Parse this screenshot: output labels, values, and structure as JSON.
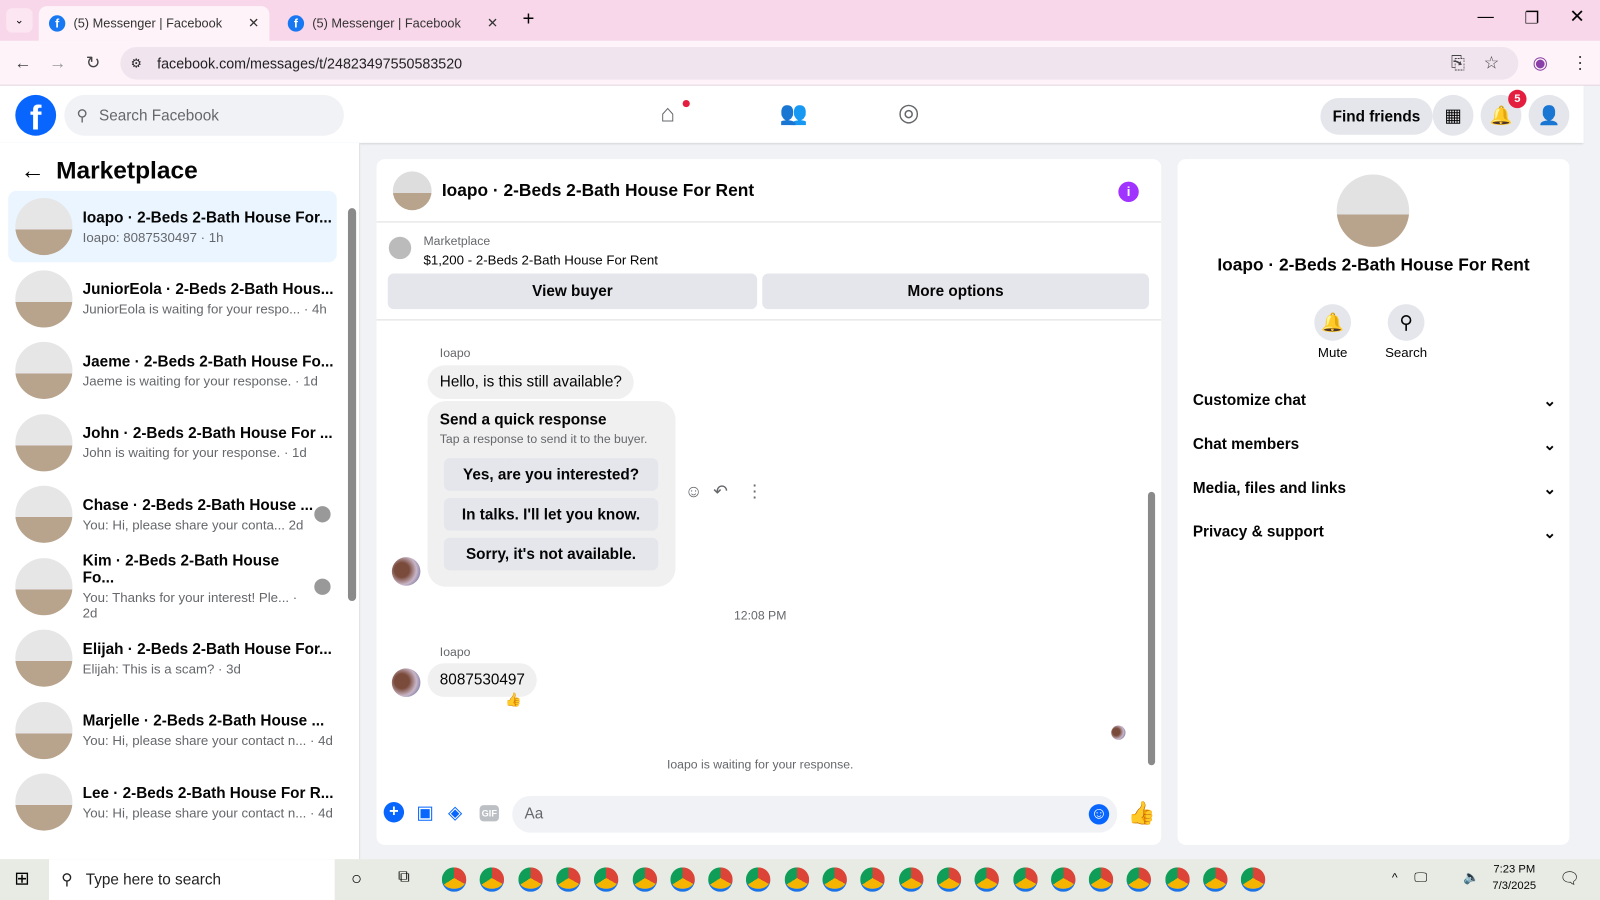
{
  "browser": {
    "tabs": [
      {
        "title": "(5) Messenger | Facebook",
        "active": true
      },
      {
        "title": "(5) Messenger | Facebook",
        "active": false
      }
    ],
    "url": "facebook.com/messages/t/24823497550583520"
  },
  "fb": {
    "search_placeholder": "Search Facebook",
    "find_friends": "Find friends",
    "notification_count": "5",
    "brand_color": "#0866ff"
  },
  "sidebar": {
    "title": "Marketplace",
    "conversations": [
      {
        "name": "Ioapo · 2-Beds 2-Bath House For...",
        "preview": "Ioapo: 8087530497 · 1h",
        "selected": true
      },
      {
        "name": "JuniorEola · 2-Beds 2-Bath Hous...",
        "preview": "JuniorEola is waiting for your respo... · 4h"
      },
      {
        "name": "Jaeme · 2-Beds 2-Bath House Fo...",
        "preview": "Jaeme is waiting for your response. · 1d"
      },
      {
        "name": "John · 2-Beds 2-Bath House For ...",
        "preview": "John is waiting for your response. · 1d"
      },
      {
        "name": "Chase · 2-Beds 2-Bath House ...",
        "preview": "You: Hi, please share your conta...   2d",
        "seen_avatar": true
      },
      {
        "name": "Kim · 2-Beds 2-Bath House Fo...",
        "preview": "You: Thanks for your interest! Ple... · 2d",
        "seen_avatar": true
      },
      {
        "name": "Elijah · 2-Beds 2-Bath House For...",
        "preview": "Elijah: This is a scam? · 3d"
      },
      {
        "name": "Marjelle · 2-Beds 2-Bath House ...",
        "preview": "You: Hi, please share your contact n... · 4d"
      },
      {
        "name": "Lee · 2-Beds 2-Bath House For R...",
        "preview": "You: Hi, please share your contact n... · 4d"
      }
    ]
  },
  "chat": {
    "title": "Ioapo · 2-Beds 2-Bath House For Rent",
    "listing_label": "Marketplace",
    "listing": "$1,200 - 2-Beds 2-Bath House For Rent",
    "view_buyer": "View buyer",
    "more_options": "More options",
    "sender": "Ioapo",
    "msg1": "Hello, is this still available?",
    "quick_title": "Send a quick response",
    "quick_sub": "Tap a response to send it to the buyer.",
    "quick": [
      "Yes, are you interested?",
      "In talks. I'll let you know.",
      "Sorry, it's not available."
    ],
    "time": "12:08 PM",
    "msg2": "8087530497",
    "reaction": "👍",
    "waiting": "Ioapo is waiting for your response.",
    "input_placeholder": "Aa"
  },
  "info": {
    "name": "Ioapo · 2-Beds 2-Bath House For Rent",
    "mute": "Mute",
    "search": "Search",
    "sections": [
      "Customize chat",
      "Chat members",
      "Media, files and links",
      "Privacy & support"
    ]
  },
  "taskbar": {
    "search_placeholder": "Type here to search",
    "time": "7:23 PM",
    "date": "7/3/2025"
  }
}
